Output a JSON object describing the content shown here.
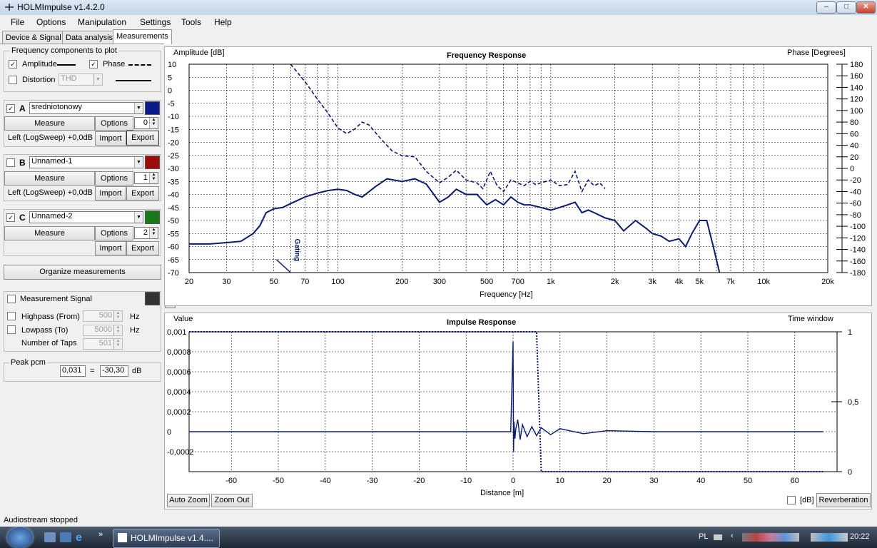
{
  "app": {
    "title": "HOLMImpulse  v1.4.2.0"
  },
  "window_controls": {
    "minimize": "–",
    "maximize": "□",
    "close": "✕"
  },
  "menu": [
    "File",
    "Options",
    "Manipulation",
    "Settings",
    "Tools",
    "Help"
  ],
  "tabs": [
    "Device & Signal",
    "Data analysis",
    "Measurements"
  ],
  "freq_components": {
    "title": "Frequency components to plot",
    "amplitude": "Amplitude",
    "phase": "Phase",
    "distortion": "Distortion",
    "distortion_value": "THD"
  },
  "measurements": [
    {
      "letter": "A",
      "checked": true,
      "name": "sredniotonowy",
      "color": "#0b1a8c",
      "measure": "Measure",
      "options": "Options",
      "num": "0",
      "info": "Left (LogSweep) +0,0dB",
      "import": "Import",
      "export": "Export"
    },
    {
      "letter": "B",
      "checked": false,
      "name": "Unnamed-1",
      "color": "#9b0b0b",
      "measure": "Measure",
      "options": "Options",
      "num": "1",
      "info": "Left (LogSweep) +0,0dB",
      "import": "Import",
      "export": "Export"
    },
    {
      "letter": "C",
      "checked": true,
      "name": "Unnamed-2",
      "color": "#1a7a1a",
      "measure": "Measure",
      "options": "Options",
      "num": "2",
      "info": "",
      "import": "Import",
      "export": "Export"
    }
  ],
  "organize": "Organize measurements",
  "signal": {
    "measurement_signal": "Measurement Signal",
    "highpass": "Highpass (From)",
    "highpass_value": "500",
    "highpass_unit": "Hz",
    "lowpass": "Lowpass (To)",
    "lowpass_value": "5000",
    "lowpass_unit": "Hz",
    "taps": "Number of Taps",
    "taps_value": "501"
  },
  "peak": {
    "title": "Peak pcm",
    "value": "0,031",
    "eq": "=",
    "db_value": "-30,30",
    "db_unit": "dB"
  },
  "freq_plot": {
    "title": "Frequency Response",
    "ylabel": "Amplitude [dB]",
    "y2label": "Phase [Degrees]",
    "xlabel": "Frequency [Hz]",
    "gating_label": "Gating",
    "y_ticks": [
      "10",
      "5",
      "0",
      "-5",
      "-10",
      "-15",
      "-20",
      "-25",
      "-30",
      "-35",
      "-40",
      "-45",
      "-50",
      "-55",
      "-60",
      "-65",
      "-70"
    ],
    "y2_ticks": [
      "180",
      "160",
      "140",
      "120",
      "100",
      "80",
      "60",
      "40",
      "20",
      "0",
      "-20",
      "-40",
      "-60",
      "-80",
      "-100",
      "-120",
      "-140",
      "-160",
      "-180"
    ],
    "x_ticks": [
      "20",
      "30",
      "50",
      "70",
      "100",
      "200",
      "300",
      "500",
      "700",
      "1k",
      "2k",
      "3k",
      "4k",
      "5k",
      "7k",
      "10k",
      "20k"
    ]
  },
  "impulse_plot": {
    "title": "Impulse Response",
    "ylabel": "Value",
    "y2label": "Time window",
    "xlabel": "Distance [m]",
    "y_ticks": [
      "0,001",
      "0,0008",
      "0,0006",
      "0,0004",
      "0,0002",
      "0",
      "-0,0002"
    ],
    "y2_ticks": [
      "1",
      "0,5",
      "0"
    ],
    "x_ticks": [
      "-60",
      "-50",
      "-40",
      "-30",
      "-20",
      "-10",
      "0",
      "10",
      "20",
      "30",
      "40",
      "50",
      "60"
    ]
  },
  "buttons": {
    "auto_zoom": "Auto Zoom",
    "zoom_out": "Zoom Out",
    "db": "[dB]",
    "reverberation": "Reverberation"
  },
  "status": "Audiostream stopped",
  "taskbar": {
    "app_button": "HOLMImpulse  v1.4....",
    "lang": "PL",
    "clock": "20:22",
    "chevron": "»"
  },
  "chart_data": [
    {
      "type": "line",
      "title": "Frequency Response",
      "xlabel": "Frequency [Hz]",
      "ylabel": "Amplitude [dB]",
      "y2label": "Phase [Degrees]",
      "xscale": "log",
      "xlim": [
        20,
        20000
      ],
      "ylim": [
        -70,
        10
      ],
      "y2lim": [
        -180,
        180
      ],
      "grid": true,
      "series": [
        {
          "style": "solid",
          "axis": "amplitude",
          "x": [
            20,
            25,
            30,
            35,
            40,
            43,
            46,
            50,
            55,
            60,
            70,
            80,
            90,
            100,
            110,
            120,
            130,
            150,
            170,
            200,
            230,
            260,
            300,
            330,
            360,
            400,
            450,
            500,
            550,
            600,
            650,
            700,
            750,
            800,
            900,
            1000,
            1100,
            1200,
            1300,
            1400,
            1500,
            1600,
            1800,
            2000,
            2200,
            2500,
            2800,
            3000,
            3300,
            3600,
            4000,
            4300,
            4600,
            5000,
            5400,
            5800,
            6200
          ],
          "y": [
            -59,
            -59,
            -58.5,
            -58,
            -55,
            -52,
            -47,
            -45.5,
            -45,
            -43.5,
            -41,
            -39.5,
            -38.5,
            -38,
            -38.5,
            -40,
            -41,
            -37,
            -34,
            -35,
            -34,
            -36,
            -43,
            -41,
            -38,
            -40,
            -40,
            -44,
            -42,
            -44,
            -41,
            -43,
            -44,
            -44,
            -45,
            -46,
            -45,
            -44,
            -43,
            -47,
            -46,
            -47,
            -49,
            -50,
            -54,
            -50,
            -53,
            -55,
            -56,
            -58,
            -57,
            -60,
            -55,
            -50,
            -50,
            -60,
            -70
          ]
        },
        {
          "style": "dashed",
          "axis": "phase",
          "x": [
            60,
            70,
            80,
            90,
            100,
            110,
            120,
            130,
            140,
            160,
            180,
            200,
            230,
            260,
            300,
            330,
            360,
            400,
            450,
            480,
            520,
            560,
            600,
            650,
            700,
            750,
            800,
            850,
            900,
            1000,
            1100,
            1200,
            1300,
            1400,
            1500,
            1600,
            1700,
            1800
          ],
          "y": [
            180,
            150,
            120,
            95,
            70,
            60,
            68,
            80,
            75,
            50,
            30,
            22,
            20,
            -5,
            -25,
            -15,
            -3,
            -20,
            -25,
            -35,
            -5,
            -30,
            -40,
            -20,
            -25,
            -30,
            -22,
            -28,
            -25,
            -20,
            -30,
            -28,
            -5,
            -40,
            -20,
            -30,
            -25,
            -35
          ]
        }
      ],
      "annotations": [
        "Gating"
      ]
    },
    {
      "type": "line",
      "title": "Impulse Response",
      "xlabel": "Distance [m]",
      "ylabel": "Value",
      "y2label": "Time window",
      "xlim": [
        -69,
        69
      ],
      "ylim": [
        -0.0004,
        0.001
      ],
      "y2lim": [
        0,
        1
      ],
      "grid": true,
      "series": [
        {
          "style": "solid",
          "axis": "value",
          "x": [
            -69,
            -1,
            -0.5,
            0,
            0.1,
            0.2,
            0.4,
            0.6,
            1,
            1.5,
            2,
            3,
            4,
            5,
            6,
            8,
            10,
            15,
            20,
            30,
            40,
            50,
            60,
            66
          ],
          "y": [
            0,
            0,
            0,
            0.0009,
            -0.0002,
            0.0001,
            -7e-05,
            3e-05,
            0.00012,
            -8e-05,
            7e-05,
            -5e-05,
            5e-05,
            -4e-05,
            4e-05,
            -3e-05,
            3e-05,
            -2e-05,
            1e-05,
            0,
            0,
            0,
            0,
            0
          ]
        },
        {
          "style": "dotted",
          "axis": "window",
          "x": [
            -69,
            0,
            5,
            6,
            66
          ],
          "y": [
            1,
            1,
            1,
            0,
            0
          ]
        }
      ]
    }
  ]
}
